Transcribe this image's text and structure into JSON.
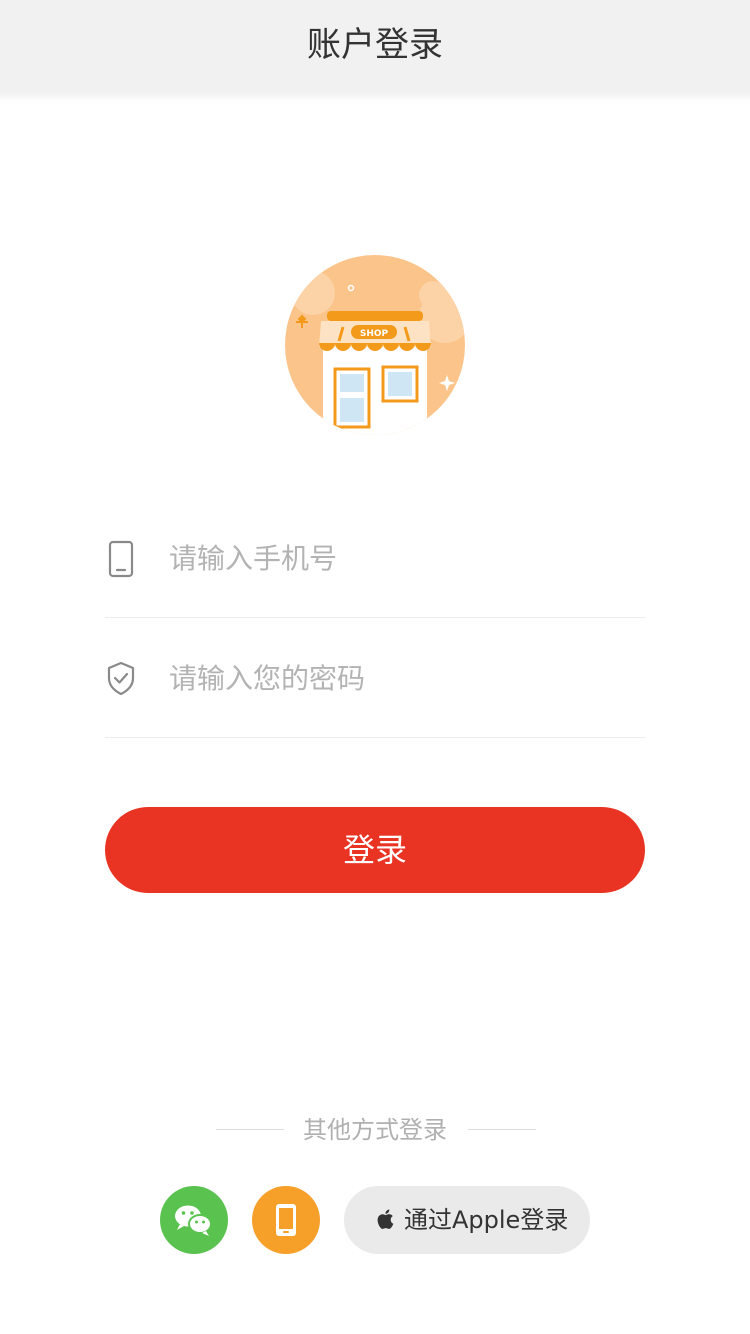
{
  "header": {
    "title": "账户登录"
  },
  "logo": {
    "sign_text": "SHOP"
  },
  "form": {
    "phone_placeholder": "请输入手机号",
    "password_placeholder": "请输入您的密码"
  },
  "login_button": {
    "label": "登录"
  },
  "other_login": {
    "title": "其他方式登录",
    "apple_label": "通过Apple登录",
    "buttons": [
      {
        "icon": "wechat-icon",
        "color": "#5ac34f"
      },
      {
        "icon": "phone-icon",
        "color": "#f6a02a"
      },
      {
        "icon": "apple-icon",
        "color": "#eaeaea"
      }
    ]
  },
  "colors": {
    "accent": "#e93323",
    "header_bg": "#f1f1f1",
    "logo_bg": "#fbc48b",
    "logo_orange": "#f39a1b"
  }
}
